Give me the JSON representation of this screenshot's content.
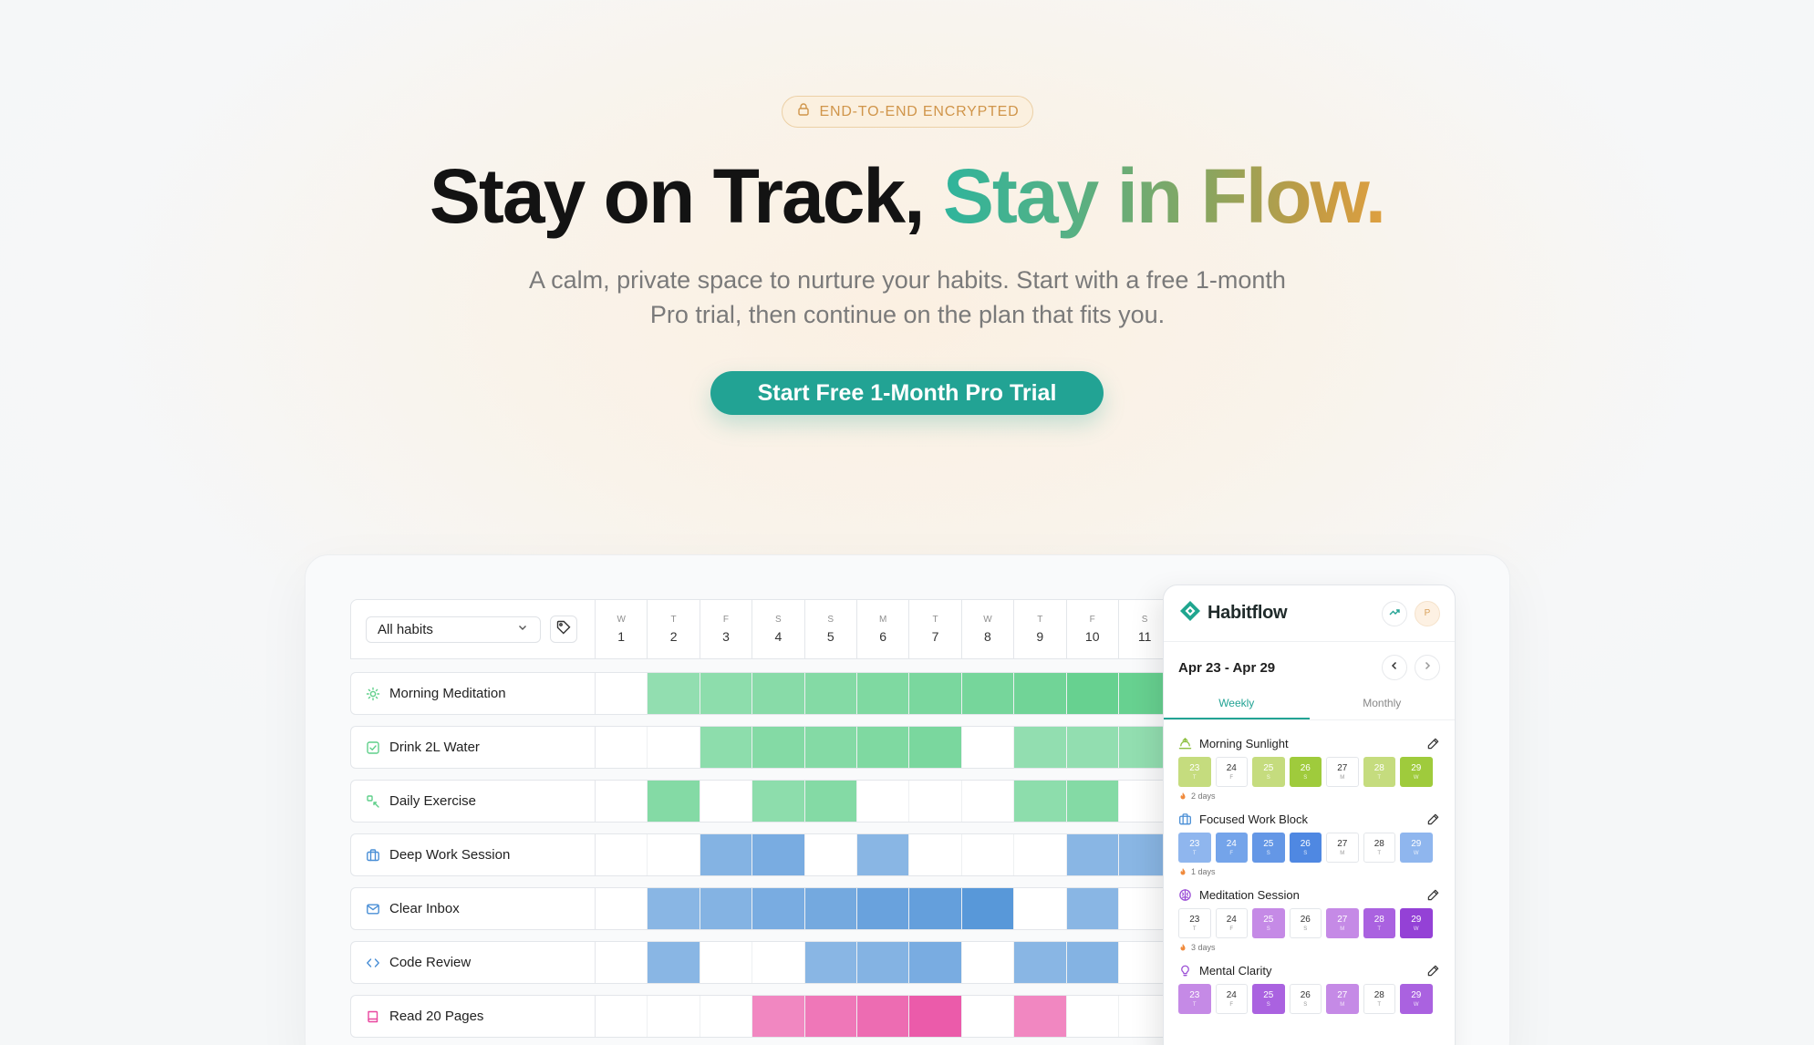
{
  "badge": {
    "label": "END-TO-END ENCRYPTED"
  },
  "hero": {
    "title_part1": "Stay on Track, ",
    "title_part2": "Stay in Flow.",
    "subtitle_line1": "A calm, private space to nurture your habits. Start with a free 1-month",
    "subtitle_line2": "Pro trial, then continue on the plan that fits you.",
    "cta_label": "Start Free 1-Month Pro Trial"
  },
  "grid": {
    "filter_label": "All habits",
    "days": [
      {
        "l": "W",
        "n": "1"
      },
      {
        "l": "T",
        "n": "2"
      },
      {
        "l": "F",
        "n": "3"
      },
      {
        "l": "S",
        "n": "4"
      },
      {
        "l": "S",
        "n": "5"
      },
      {
        "l": "M",
        "n": "6"
      },
      {
        "l": "T",
        "n": "7"
      },
      {
        "l": "W",
        "n": "8"
      },
      {
        "l": "T",
        "n": "9"
      },
      {
        "l": "F",
        "n": "10"
      },
      {
        "l": "S",
        "n": "11"
      }
    ],
    "habits": [
      {
        "name": "Morning Meditation",
        "icon": "sun-icon",
        "color": "#5fcf8a",
        "levels": [
          0,
          0.55,
          0.6,
          0.65,
          0.7,
          0.75,
          0.8,
          0.85,
          0.9,
          1,
          1
        ]
      },
      {
        "name": "Drink 2L Water",
        "icon": "check-square-icon",
        "color": "#5fcf8a",
        "levels": [
          0,
          0,
          0.6,
          0.7,
          0.7,
          0.75,
          0.8,
          0,
          0.55,
          0.55,
          0.55
        ]
      },
      {
        "name": "Daily Exercise",
        "icon": "exercise-icon",
        "color": "#5fcf8a",
        "levels": [
          0,
          0.7,
          0,
          0.6,
          0.7,
          0,
          0,
          0,
          0.6,
          0.7,
          0
        ]
      },
      {
        "name": "Deep Work Session",
        "icon": "briefcase-icon",
        "color": "#4a8fd6",
        "levels": [
          0,
          0,
          0.55,
          0.65,
          0,
          0.5,
          0,
          0,
          0,
          0.5,
          0.5
        ]
      },
      {
        "name": "Clear Inbox",
        "icon": "mail-icon",
        "color": "#4a8fd6",
        "levels": [
          0,
          0.5,
          0.55,
          0.65,
          0.7,
          0.8,
          0.85,
          0.95,
          0,
          0.5,
          0
        ]
      },
      {
        "name": "Code Review",
        "icon": "code-icon",
        "color": "#4a8fd6",
        "levels": [
          0,
          0.5,
          0,
          0,
          0.5,
          0.55,
          0.65,
          0,
          0.5,
          0.55,
          0
        ]
      },
      {
        "name": "Read 20 Pages",
        "icon": "book-icon",
        "color": "#e9479f",
        "levels": [
          0,
          0,
          0,
          0.5,
          0.65,
          0.75,
          0.9,
          0,
          0.5,
          0,
          0
        ]
      }
    ]
  },
  "panel": {
    "brand": "Habitflow",
    "avatar_initial": "P",
    "range": "Apr 23 - Apr 29",
    "tabs": [
      "Weekly",
      "Monthly"
    ],
    "habits": [
      {
        "name": "Morning Sunlight",
        "icon": "sunrise-icon",
        "iconColor": "#8dbf3f",
        "streak": "2 days",
        "days": [
          {
            "n": "23",
            "w": "T",
            "c": "#c5dc7e"
          },
          {
            "n": "24",
            "w": "F",
            "c": ""
          },
          {
            "n": "25",
            "w": "S",
            "c": "#c5dc7e"
          },
          {
            "n": "26",
            "w": "S",
            "c": "#9fcb3c"
          },
          {
            "n": "27",
            "w": "M",
            "c": ""
          },
          {
            "n": "28",
            "w": "T",
            "c": "#c5dc7e"
          },
          {
            "n": "29",
            "w": "W",
            "c": "#9fcb3c"
          }
        ]
      },
      {
        "name": "Focused Work Block",
        "icon": "briefcase-icon",
        "iconColor": "#4a8fd6",
        "streak": "1 days",
        "days": [
          {
            "n": "23",
            "w": "T",
            "c": "#8fb6ee"
          },
          {
            "n": "24",
            "w": "F",
            "c": "#74a4ea"
          },
          {
            "n": "25",
            "w": "S",
            "c": "#6497e6"
          },
          {
            "n": "26",
            "w": "S",
            "c": "#4f88e2"
          },
          {
            "n": "27",
            "w": "M",
            "c": ""
          },
          {
            "n": "28",
            "w": "T",
            "c": ""
          },
          {
            "n": "29",
            "w": "W",
            "c": "#8fb6ee"
          }
        ]
      },
      {
        "name": "Meditation Session",
        "icon": "brain-icon",
        "iconColor": "#9b4fd6",
        "streak": "3 days",
        "days": [
          {
            "n": "23",
            "w": "T",
            "c": ""
          },
          {
            "n": "24",
            "w": "F",
            "c": ""
          },
          {
            "n": "25",
            "w": "S",
            "c": "#c58ae6"
          },
          {
            "n": "26",
            "w": "S",
            "c": ""
          },
          {
            "n": "27",
            "w": "M",
            "c": "#c58ae6"
          },
          {
            "n": "28",
            "w": "T",
            "c": "#aa62e0"
          },
          {
            "n": "29",
            "w": "W",
            "c": "#9441d6"
          }
        ]
      },
      {
        "name": "Mental Clarity",
        "icon": "lightbulb-icon",
        "iconColor": "#9b4fd6",
        "streak": "",
        "days": [
          {
            "n": "23",
            "w": "T",
            "c": "#c58ae6"
          },
          {
            "n": "24",
            "w": "F",
            "c": ""
          },
          {
            "n": "25",
            "w": "S",
            "c": "#aa62e0"
          },
          {
            "n": "26",
            "w": "S",
            "c": ""
          },
          {
            "n": "27",
            "w": "M",
            "c": "#c58ae6"
          },
          {
            "n": "28",
            "w": "T",
            "c": ""
          },
          {
            "n": "29",
            "w": "W",
            "c": "#aa62e0"
          }
        ]
      }
    ]
  }
}
